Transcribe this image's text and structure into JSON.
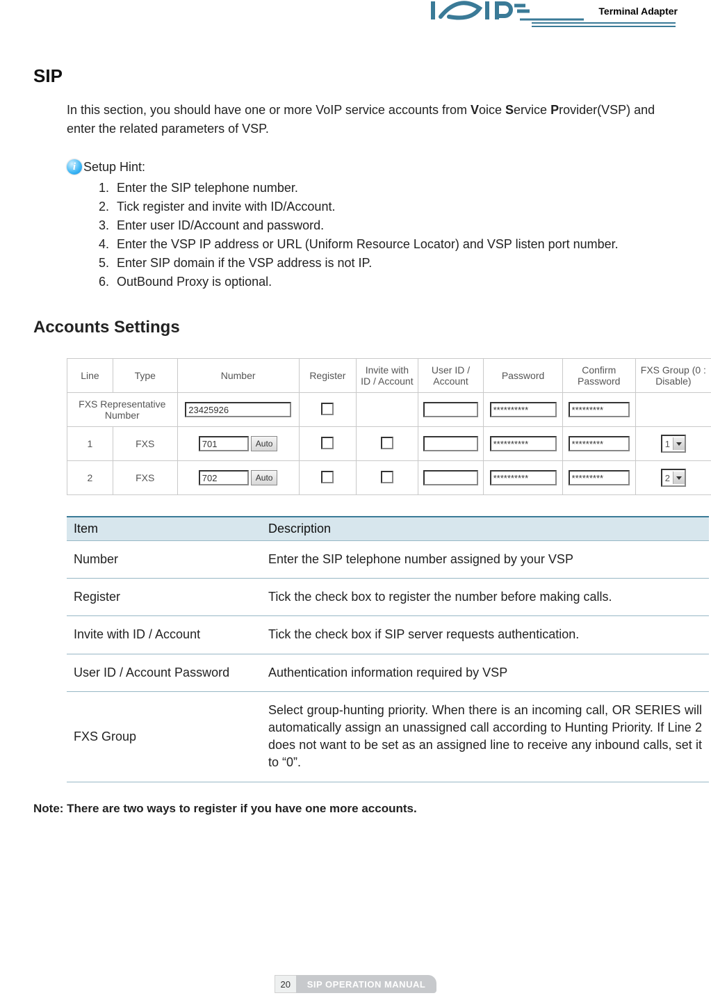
{
  "header": {
    "product_label": "Terminal Adapter"
  },
  "section": {
    "title": "SIP",
    "intro_pre": "In this section, you should have one or more VoIP service accounts from ",
    "intro_b1": "V",
    "intro_a1": "oice ",
    "intro_b2": "S",
    "intro_a2": "ervice ",
    "intro_b3": "P",
    "intro_a3": "rovider(VSP) and enter the related parameters of VSP."
  },
  "hint": {
    "label": "Setup Hint:",
    "steps": [
      "Enter the SIP telephone number.",
      "Tick register and invite with ID/Account.",
      "Enter user ID/Account and password.",
      "Enter the VSP IP address or URL (Uniform Resource Locator) and VSP listen port number.",
      "Enter SIP domain if the VSP address is not IP.",
      "OutBound Proxy is optional."
    ]
  },
  "accounts": {
    "heading": "Accounts Settings",
    "cols": {
      "line": "Line",
      "type": "Type",
      "number": "Number",
      "register": "Register",
      "invite": "Invite with ID / Account",
      "userid": "User ID / Account",
      "password": "Password",
      "confirm": "Confirm Password",
      "fxsgroup": "FXS Group (0 : Disable)"
    },
    "rep_label": "FXS Representative Number",
    "rep_number": "23425926",
    "rep_pwd": "**********",
    "rep_cpwd": "*********",
    "auto_label": "Auto",
    "rows": [
      {
        "line": "1",
        "type": "FXS",
        "number": "701",
        "pwd": "**********",
        "cpwd": "*********",
        "fxs": "1"
      },
      {
        "line": "2",
        "type": "FXS",
        "number": "702",
        "pwd": "**********",
        "cpwd": "*********",
        "fxs": "2"
      }
    ]
  },
  "desc": {
    "head_item": "Item",
    "head_desc": "Description",
    "rows": [
      {
        "item": "Number",
        "desc": "Enter the SIP telephone number assigned by your VSP"
      },
      {
        "item": "Register",
        "desc": "Tick the check box to register the number before making calls."
      },
      {
        "item": "Invite with ID / Account",
        "desc": "Tick the check box if SIP server requests authentication."
      },
      {
        "item": "User ID / Account Password",
        "desc": "Authentication information required by VSP"
      },
      {
        "item": "FXS Group",
        "desc": "Select group-hunting priority. When there is an incoming call, OR SERIES will automatically assign an unassigned call according to Hunting Priority. If Line 2 does not want to be set as an assigned line to receive any inbound calls, set it to “0”."
      }
    ]
  },
  "note": "Note: There are two ways to register if you have one more accounts.",
  "footer": {
    "page": "20",
    "title": "SIP OPERATION MANUAL"
  }
}
